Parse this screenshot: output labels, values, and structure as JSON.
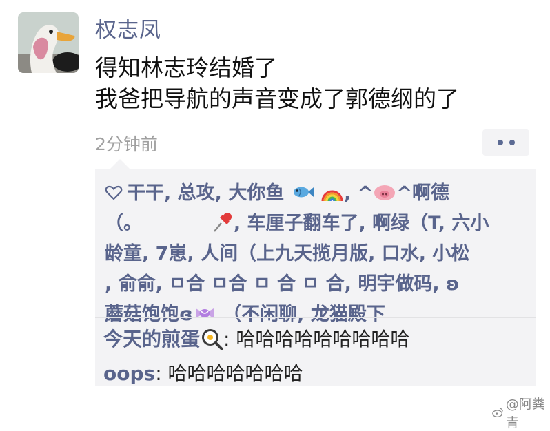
{
  "post": {
    "username": "权志凤",
    "lines": [
      "得知林志玲结婚了",
      "我爸把导航的声音变成了郭德纲的了"
    ],
    "time": "2分钟前"
  },
  "likes": {
    "lines": [
      "干干, 总攻, 大你鱼",
      ", ^",
      "^啊德",
      "（。",
      ", 车厘子翻车了, 啊绿（T, 六小",
      "龄童, 7崽, 人间（上九天揽月版, 口水, 小松",
      ", 俞俞, ㅁ合 ㅁ合 ㅁ 合 ㅁ 合, 明宇做码, ʚ",
      "蘑菇饱饱ɞ",
      "（不闲聊, 龙猫殿下"
    ]
  },
  "comments": [
    {
      "author": "今天的煎蛋",
      "sep": ": ",
      "text": "哈哈哈哈哈哈哈哈哈"
    },
    {
      "author": "oops",
      "sep": ": ",
      "text": "哈哈哈哈哈哈哈"
    }
  ],
  "watermark": "@阿粪青",
  "icons": [
    "heart-icon",
    "fish-emoji",
    "rainbow-emoji",
    "pig-emoji",
    "pushpin-emoji",
    "candy-emoji",
    "fried-egg-emoji",
    "weibo-icon"
  ],
  "colors": {
    "name": "#59648c",
    "time": "#a0a0a0",
    "comment_bg": "#f3f3f5"
  }
}
